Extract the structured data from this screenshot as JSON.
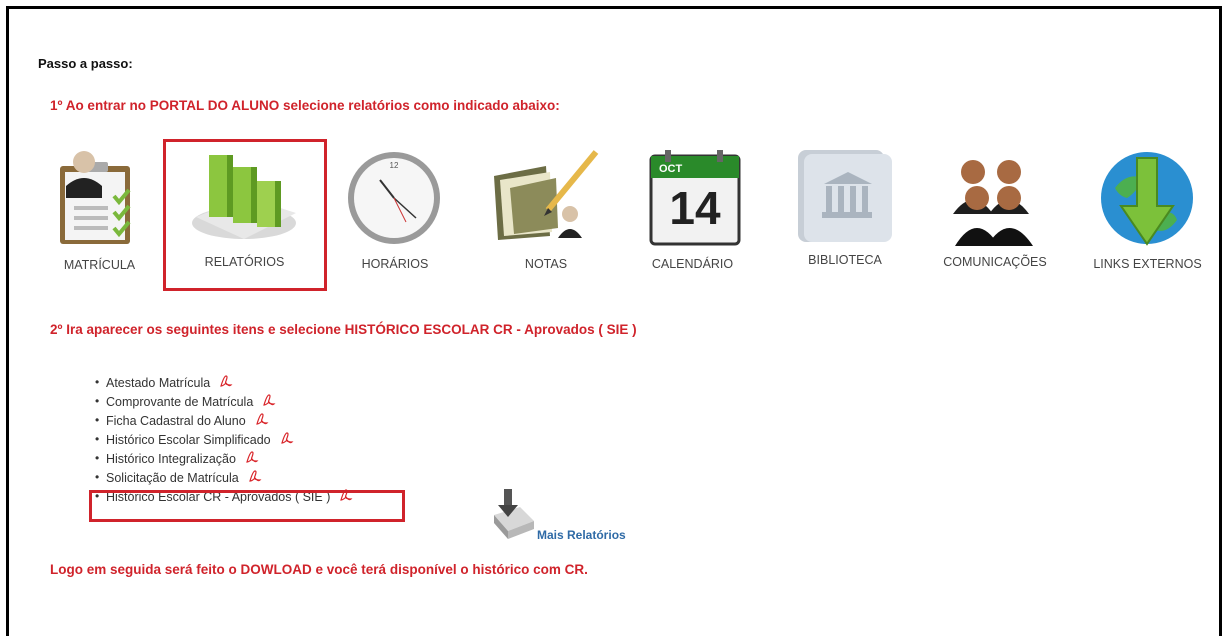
{
  "intro": "Passo a passo:",
  "step1": "1º Ao entrar no PORTAL DO ALUNO selecione relatórios como indicado abaixo:",
  "tiles": [
    {
      "label": "MATRÍCULA",
      "icon": "clipboard-checklist-icon"
    },
    {
      "label": "RELATÓRIOS",
      "icon": "bar-chart-icon"
    },
    {
      "label": "HORÁRIOS",
      "icon": "clock-icon"
    },
    {
      "label": "NOTAS",
      "icon": "folder-pencil-icon"
    },
    {
      "label": "CALENDÁRIO",
      "icon": "calendar-icon",
      "month": "OCT",
      "day": "14"
    },
    {
      "label": "BIBLIOTECA",
      "icon": "library-book-icon"
    },
    {
      "label": "COMUNICAÇÕES",
      "icon": "people-icon"
    },
    {
      "label": "LINKS EXTERNOS",
      "icon": "globe-download-icon"
    }
  ],
  "step2": "2º Ira aparecer os seguintes itens e selecione HISTÓRICO ESCOLAR CR - Aprovados ( SIE )",
  "reports": [
    "Atestado Matrícula",
    "Comprovante de Matrícula",
    "Ficha Cadastral do Aluno",
    "Histórico Escolar Simplificado",
    "Histórico Integralização",
    "Solicitação de Matrícula",
    "Histórico Escolar CR - Aprovados ( SIE )"
  ],
  "more_reports": "Mais Relatórios",
  "final": "Logo em seguida será feito o DOWLOAD e você terá disponível o histórico com CR.",
  "colors": {
    "highlight_red": "#d0232b",
    "link_blue": "#2e6aa6",
    "pdf_red": "#d9262b"
  }
}
